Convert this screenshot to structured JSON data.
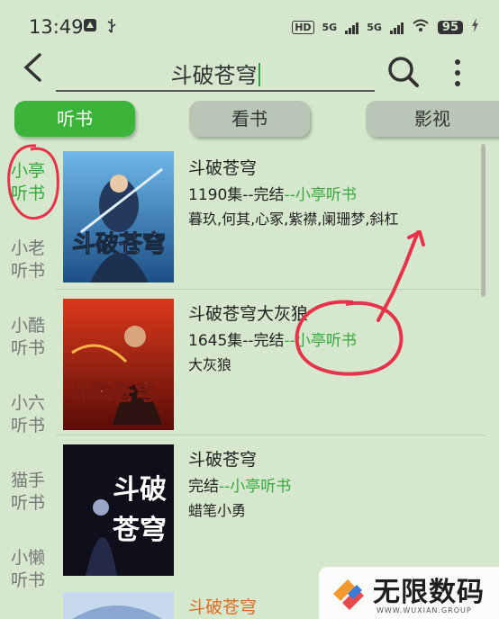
{
  "status_bar": {
    "time": "13:49",
    "hd_label": "HD",
    "net1": "5G",
    "net2": "5G",
    "battery": "95"
  },
  "search": {
    "query": "斗破苍穹",
    "back_icon": "back-arrow-icon",
    "search_icon": "search-icon",
    "more_icon": "more-vertical-icon"
  },
  "tabs": [
    {
      "label": "听书",
      "active": true
    },
    {
      "label": "看书",
      "active": false
    },
    {
      "label": "影视",
      "active": false
    }
  ],
  "sidebar": {
    "items": [
      {
        "label_line1": "小亭",
        "label_line2": "听书",
        "active": true
      },
      {
        "label_line1": "小老",
        "label_line2": "听书",
        "active": false
      },
      {
        "label_line1": "小酷",
        "label_line2": "听书",
        "active": false
      },
      {
        "label_line1": "小六",
        "label_line2": "听书",
        "active": false
      },
      {
        "label_line1": "猫手",
        "label_line2": "听书",
        "active": false
      },
      {
        "label_line1": "小懒",
        "label_line2": "听书",
        "active": false
      }
    ]
  },
  "results": [
    {
      "title": "斗破苍穹",
      "episodes": "1190集",
      "status": "--完结",
      "source": "--小亭听书",
      "narrators": "暮玖,何其,心冢,紫襟,阑珊梦,斜杠"
    },
    {
      "title": "斗破苍穹大灰狼",
      "episodes": "1645集",
      "status": "--完结",
      "source": "--小亭听书",
      "narrators": "大灰狼"
    },
    {
      "title": "斗破苍穹",
      "episodes": "",
      "status": "完结",
      "source": "--小亭听书",
      "narrators": "蜡笔小勇"
    },
    {
      "title": "斗破苍穹",
      "episodes": "",
      "status": "",
      "source": "",
      "narrators": ""
    }
  ],
  "watermark": {
    "brand": "无限数码",
    "domain": "WWW.WUXIAN.GROUP"
  },
  "colors": {
    "background": "#d5e8cd",
    "accent_green": "#36a83a",
    "annotation_red": "#e8324a",
    "highlight_orange": "#e06a1f"
  }
}
